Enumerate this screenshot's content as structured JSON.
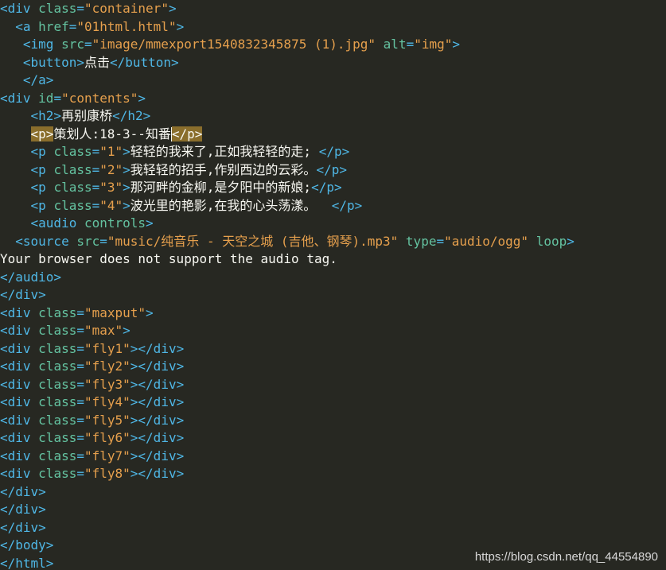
{
  "colors": {
    "background": "#272822",
    "tag": "#4fb7e6",
    "attribute": "#64c2a0",
    "string": "#e6a04d",
    "text": "#f8f8f2",
    "match_highlight": "#8a6e2c"
  },
  "lines": [
    [
      {
        "t": "tag",
        "v": "<div "
      },
      {
        "t": "attr",
        "v": "class"
      },
      {
        "t": "tag",
        "v": "="
      },
      {
        "t": "str",
        "v": "\"container\""
      },
      {
        "t": "tag",
        "v": ">"
      }
    ],
    [
      {
        "t": "tag",
        "v": "  <a "
      },
      {
        "t": "attr",
        "v": "href"
      },
      {
        "t": "tag",
        "v": "="
      },
      {
        "t": "str",
        "v": "\"01html.html\""
      },
      {
        "t": "tag",
        "v": ">"
      }
    ],
    [
      {
        "t": "tag",
        "v": "   <img "
      },
      {
        "t": "attr",
        "v": "src"
      },
      {
        "t": "tag",
        "v": "="
      },
      {
        "t": "str",
        "v": "\"image/mmexport1540832345875 (1).jpg\""
      },
      {
        "t": "tag",
        "v": " "
      },
      {
        "t": "attr",
        "v": "alt"
      },
      {
        "t": "tag",
        "v": "="
      },
      {
        "t": "str",
        "v": "\"img\""
      },
      {
        "t": "tag",
        "v": ">"
      }
    ],
    [
      {
        "t": "tag",
        "v": "   <button>"
      },
      {
        "t": "text",
        "v": "点击"
      },
      {
        "t": "tag",
        "v": "</button>"
      }
    ],
    [
      {
        "t": "tag",
        "v": "   </a>"
      }
    ],
    [
      {
        "t": "tag",
        "v": "<div "
      },
      {
        "t": "attr",
        "v": "id"
      },
      {
        "t": "tag",
        "v": "="
      },
      {
        "t": "str",
        "v": "\"contents\""
      },
      {
        "t": "tag",
        "v": ">"
      }
    ],
    [
      {
        "t": "tag",
        "v": "    <h2>"
      },
      {
        "t": "text",
        "v": "再别康桥"
      },
      {
        "t": "tag",
        "v": "</h2>"
      }
    ],
    [
      {
        "t": "tag",
        "v": "    "
      },
      {
        "t": "hl",
        "v": "<p>"
      },
      {
        "t": "text",
        "v": "策划人:18-3--知番"
      },
      {
        "t": "cursor",
        "v": ""
      },
      {
        "t": "hl",
        "v": "</p>"
      }
    ],
    [
      {
        "t": "tag",
        "v": "    <p "
      },
      {
        "t": "attr",
        "v": "class"
      },
      {
        "t": "tag",
        "v": "="
      },
      {
        "t": "str",
        "v": "\"1\""
      },
      {
        "t": "tag",
        "v": ">"
      },
      {
        "t": "text",
        "v": "轻轻的我来了,正如我轻轻的走; "
      },
      {
        "t": "tag",
        "v": "</p>"
      }
    ],
    [
      {
        "t": "tag",
        "v": "    <p "
      },
      {
        "t": "attr",
        "v": "class"
      },
      {
        "t": "tag",
        "v": "="
      },
      {
        "t": "str",
        "v": "\"2\""
      },
      {
        "t": "tag",
        "v": ">"
      },
      {
        "t": "text",
        "v": "我轻轻的招手,作别西边的云彩。"
      },
      {
        "t": "tag",
        "v": "</p>"
      }
    ],
    [
      {
        "t": "tag",
        "v": "    <p "
      },
      {
        "t": "attr",
        "v": "class"
      },
      {
        "t": "tag",
        "v": "="
      },
      {
        "t": "str",
        "v": "\"3\""
      },
      {
        "t": "tag",
        "v": ">"
      },
      {
        "t": "text",
        "v": "那河畔的金柳,是夕阳中的新娘;"
      },
      {
        "t": "tag",
        "v": "</p>"
      }
    ],
    [
      {
        "t": "tag",
        "v": "    <p "
      },
      {
        "t": "attr",
        "v": "class"
      },
      {
        "t": "tag",
        "v": "="
      },
      {
        "t": "str",
        "v": "\"4\""
      },
      {
        "t": "tag",
        "v": ">"
      },
      {
        "t": "text",
        "v": "波光里的艳影,在我的心头荡漾。  "
      },
      {
        "t": "tag",
        "v": "</p>"
      }
    ],
    [
      {
        "t": "tag",
        "v": "    <audio "
      },
      {
        "t": "attr",
        "v": "controls"
      },
      {
        "t": "tag",
        "v": ">"
      }
    ],
    [
      {
        "t": "tag",
        "v": "  <source "
      },
      {
        "t": "attr",
        "v": "src"
      },
      {
        "t": "tag",
        "v": "="
      },
      {
        "t": "str",
        "v": "\"music/纯音乐 - 天空之城 (吉他、钢琴).mp3\""
      },
      {
        "t": "tag",
        "v": " "
      },
      {
        "t": "attr",
        "v": "type"
      },
      {
        "t": "tag",
        "v": "="
      },
      {
        "t": "str",
        "v": "\"audio/ogg\""
      },
      {
        "t": "tag",
        "v": " "
      },
      {
        "t": "attr",
        "v": "loop"
      },
      {
        "t": "tag",
        "v": ">"
      }
    ],
    [
      {
        "t": "text",
        "v": "Your browser does not support the audio tag."
      }
    ],
    [
      {
        "t": "tag",
        "v": "</audio>"
      }
    ],
    [
      {
        "t": "tag",
        "v": "</div>"
      }
    ],
    [
      {
        "t": "tag",
        "v": "<div "
      },
      {
        "t": "attr",
        "v": "class"
      },
      {
        "t": "tag",
        "v": "="
      },
      {
        "t": "str",
        "v": "\"maxput\""
      },
      {
        "t": "tag",
        "v": ">"
      }
    ],
    [
      {
        "t": "tag",
        "v": "<div "
      },
      {
        "t": "attr",
        "v": "class"
      },
      {
        "t": "tag",
        "v": "="
      },
      {
        "t": "str",
        "v": "\"max\""
      },
      {
        "t": "tag",
        "v": ">"
      }
    ],
    [
      {
        "t": "tag",
        "v": "<div "
      },
      {
        "t": "attr",
        "v": "class"
      },
      {
        "t": "tag",
        "v": "="
      },
      {
        "t": "str",
        "v": "\"fly1\""
      },
      {
        "t": "tag",
        "v": "></div>"
      }
    ],
    [
      {
        "t": "tag",
        "v": "<div "
      },
      {
        "t": "attr",
        "v": "class"
      },
      {
        "t": "tag",
        "v": "="
      },
      {
        "t": "str",
        "v": "\"fly2\""
      },
      {
        "t": "tag",
        "v": "></div>"
      }
    ],
    [
      {
        "t": "tag",
        "v": "<div "
      },
      {
        "t": "attr",
        "v": "class"
      },
      {
        "t": "tag",
        "v": "="
      },
      {
        "t": "str",
        "v": "\"fly3\""
      },
      {
        "t": "tag",
        "v": "></div>"
      }
    ],
    [
      {
        "t": "tag",
        "v": "<div "
      },
      {
        "t": "attr",
        "v": "class"
      },
      {
        "t": "tag",
        "v": "="
      },
      {
        "t": "str",
        "v": "\"fly4\""
      },
      {
        "t": "tag",
        "v": "></div>"
      }
    ],
    [
      {
        "t": "tag",
        "v": "<div "
      },
      {
        "t": "attr",
        "v": "class"
      },
      {
        "t": "tag",
        "v": "="
      },
      {
        "t": "str",
        "v": "\"fly5\""
      },
      {
        "t": "tag",
        "v": "></div>"
      }
    ],
    [
      {
        "t": "tag",
        "v": "<div "
      },
      {
        "t": "attr",
        "v": "class"
      },
      {
        "t": "tag",
        "v": "="
      },
      {
        "t": "str",
        "v": "\"fly6\""
      },
      {
        "t": "tag",
        "v": "></div>"
      }
    ],
    [
      {
        "t": "tag",
        "v": "<div "
      },
      {
        "t": "attr",
        "v": "class"
      },
      {
        "t": "tag",
        "v": "="
      },
      {
        "t": "str",
        "v": "\"fly7\""
      },
      {
        "t": "tag",
        "v": "></div>"
      }
    ],
    [
      {
        "t": "tag",
        "v": "<div "
      },
      {
        "t": "attr",
        "v": "class"
      },
      {
        "t": "tag",
        "v": "="
      },
      {
        "t": "str",
        "v": "\"fly8\""
      },
      {
        "t": "tag",
        "v": "></div>"
      }
    ],
    [
      {
        "t": "tag",
        "v": "</div>"
      }
    ],
    [
      {
        "t": "tag",
        "v": "</div>"
      }
    ],
    [
      {
        "t": "tag",
        "v": "</div>"
      }
    ],
    [
      {
        "t": "tag",
        "v": "</body>"
      }
    ],
    [
      {
        "t": "tag",
        "v": "</html>"
      }
    ]
  ],
  "watermark": "https://blog.csdn.net/qq_44554890"
}
